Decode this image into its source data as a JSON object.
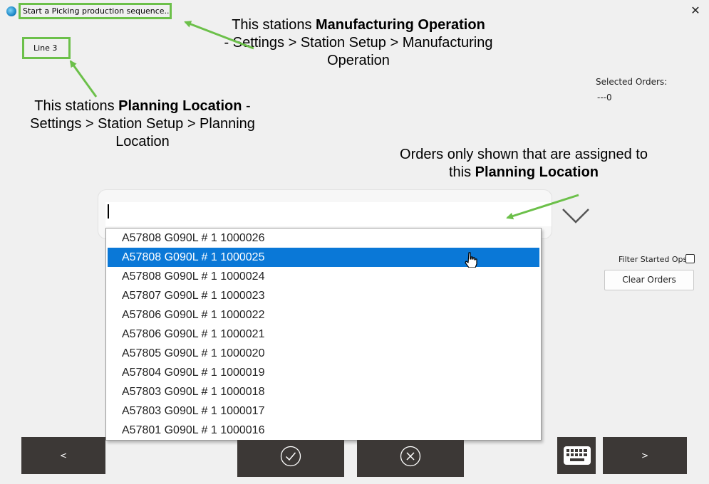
{
  "window": {
    "title": "Start a Picking production sequence...",
    "close_glyph": "✕",
    "app_icon": "app-globe-icon"
  },
  "station": {
    "line_label": "Line 3"
  },
  "annotations": {
    "mfg_op": {
      "prefix": "This stations ",
      "bold": "Manufacturing Operation",
      "rest": "- Settings > Station Setup > Manufacturing Operation"
    },
    "planning": {
      "prefix": "This stations ",
      "bold": "Planning Location",
      "suffix": " -",
      "rest": "Settings > Station Setup > Planning Location"
    },
    "orders": {
      "line1": "Orders only shown that are assigned to",
      "prefix": "this ",
      "bold": "Planning Location"
    },
    "accent_color": "#6cc04a"
  },
  "selected_orders": {
    "label": "Selected Orders:",
    "value": "---0"
  },
  "order_combo": {
    "value": "",
    "selected_index": 1,
    "selection_color": "#0a78d7",
    "items": [
      "A57808 G090L # 1 1000026",
      "A57808 G090L # 1 1000025",
      "A57808 G090L # 1 1000024",
      "A57807 G090L # 1 1000023",
      "A57806 G090L # 1 1000022",
      "A57806 G090L # 1 1000021",
      "A57805 G090L # 1 1000020",
      "A57804 G090L # 1 1000019",
      "A57803 G090L # 1 1000018",
      "A57803 G090L # 1 1000017",
      "A57801 G090L # 1 1000016"
    ]
  },
  "filter": {
    "label": "Filter Started Ops",
    "checked": false
  },
  "buttons": {
    "clear_orders": "Clear Orders",
    "prev": "<",
    "next": ">",
    "ok_icon": "check-circle-icon",
    "cancel_icon": "x-circle-icon",
    "keyboard_icon": "keyboard-icon",
    "bg_color": "#3c3836"
  }
}
